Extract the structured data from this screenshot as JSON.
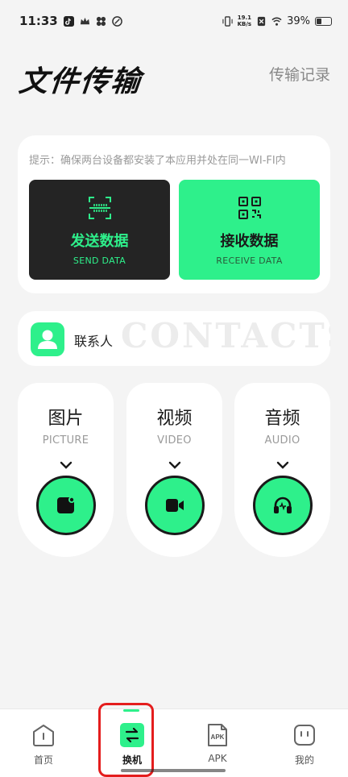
{
  "status_bar": {
    "time": "11:33",
    "net_speed_value": "19.1",
    "net_speed_unit": "KB/s",
    "battery": "39%",
    "battery_level": 0.39
  },
  "header": {
    "title": "文件传输",
    "history_label": "传输记录"
  },
  "transfer": {
    "tip": "提示：确保两台设备都安装了本应用并处在同一WI-FI内",
    "send": {
      "label_cn": "发送数据",
      "label_en": "SEND DATA",
      "icon": "scan-icon"
    },
    "receive": {
      "label_cn": "接收数据",
      "label_en": "RECEIVE DATA",
      "icon": "qr-code-icon"
    }
  },
  "contacts": {
    "label": "联系人",
    "watermark": "CONTACTS",
    "icon": "person-icon"
  },
  "media": [
    {
      "title": "图片",
      "subtitle": "PICTURE",
      "icon": "image-icon"
    },
    {
      "title": "视频",
      "subtitle": "VIDEO",
      "icon": "video-camera-icon"
    },
    {
      "title": "音频",
      "subtitle": "AUDIO",
      "icon": "headphones-icon"
    }
  ],
  "nav": [
    {
      "label": "首页",
      "icon": "home-icon"
    },
    {
      "label": "换机",
      "icon": "swap-icon",
      "active": true
    },
    {
      "label": "APK",
      "icon": "apk-icon",
      "icon_text": "APK"
    },
    {
      "label": "我的",
      "icon": "face-icon"
    }
  ],
  "colors": {
    "accent": "#2ef08b",
    "dark": "#242424",
    "highlight": "#e41d1d"
  }
}
